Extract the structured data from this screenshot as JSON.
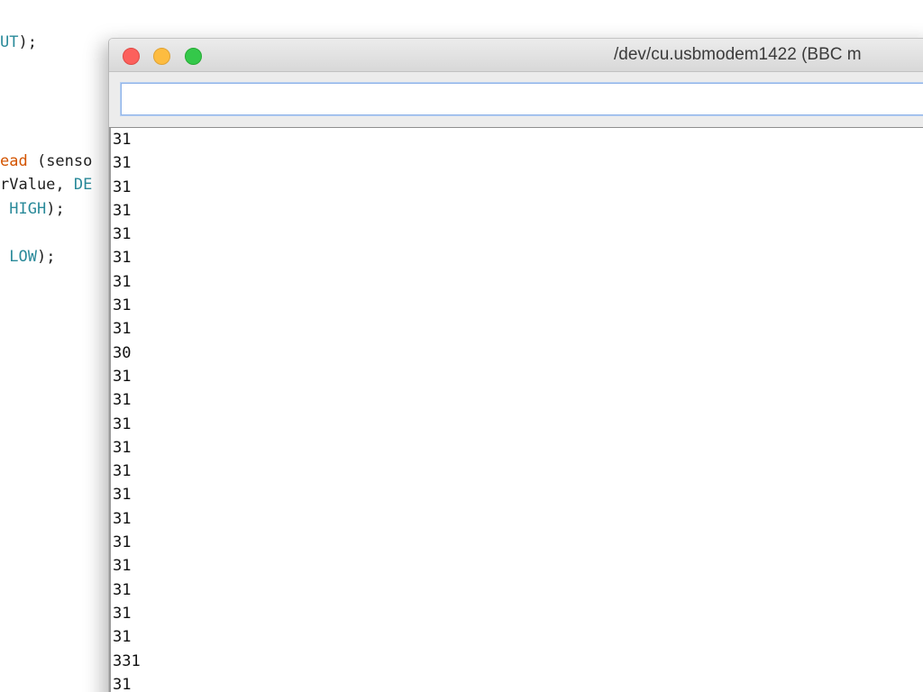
{
  "editor": {
    "lines": [
      {
        "segments": [
          {
            "text": "UT",
            "kind": "const"
          },
          {
            "text": ");",
            "kind": "plain"
          }
        ]
      },
      {
        "segments": [
          {
            "text": "ead",
            "kind": "func"
          },
          {
            "text": " (senso",
            "kind": "plain"
          }
        ]
      },
      {
        "segments": [
          {
            "text": "rValue, ",
            "kind": "plain"
          },
          {
            "text": "DE",
            "kind": "const"
          }
        ]
      },
      {
        "segments": [
          {
            "text": " ",
            "kind": "plain"
          },
          {
            "text": "HIGH",
            "kind": "const"
          },
          {
            "text": ");",
            "kind": "plain"
          }
        ]
      },
      {
        "segments": [
          {
            "text": " ",
            "kind": "plain"
          },
          {
            "text": "LOW",
            "kind": "const"
          },
          {
            "text": ");",
            "kind": "plain"
          }
        ]
      }
    ]
  },
  "serial_monitor": {
    "title": "/dev/cu.usbmodem1422 (BBC m",
    "input_value": "",
    "output_lines": [
      "31",
      "31",
      "31",
      "31",
      "31",
      "31",
      "31",
      "31",
      "31",
      "30",
      "31",
      "31",
      "31",
      "31",
      "31",
      "31",
      "31",
      "31",
      "31",
      "31",
      "31",
      "31",
      "331",
      "31"
    ]
  },
  "colors": {
    "close": "#fc605c",
    "minimize": "#fdbc40",
    "maximize": "#34c84a",
    "code_constant": "#2a8a9a",
    "code_function": "#d35400"
  }
}
